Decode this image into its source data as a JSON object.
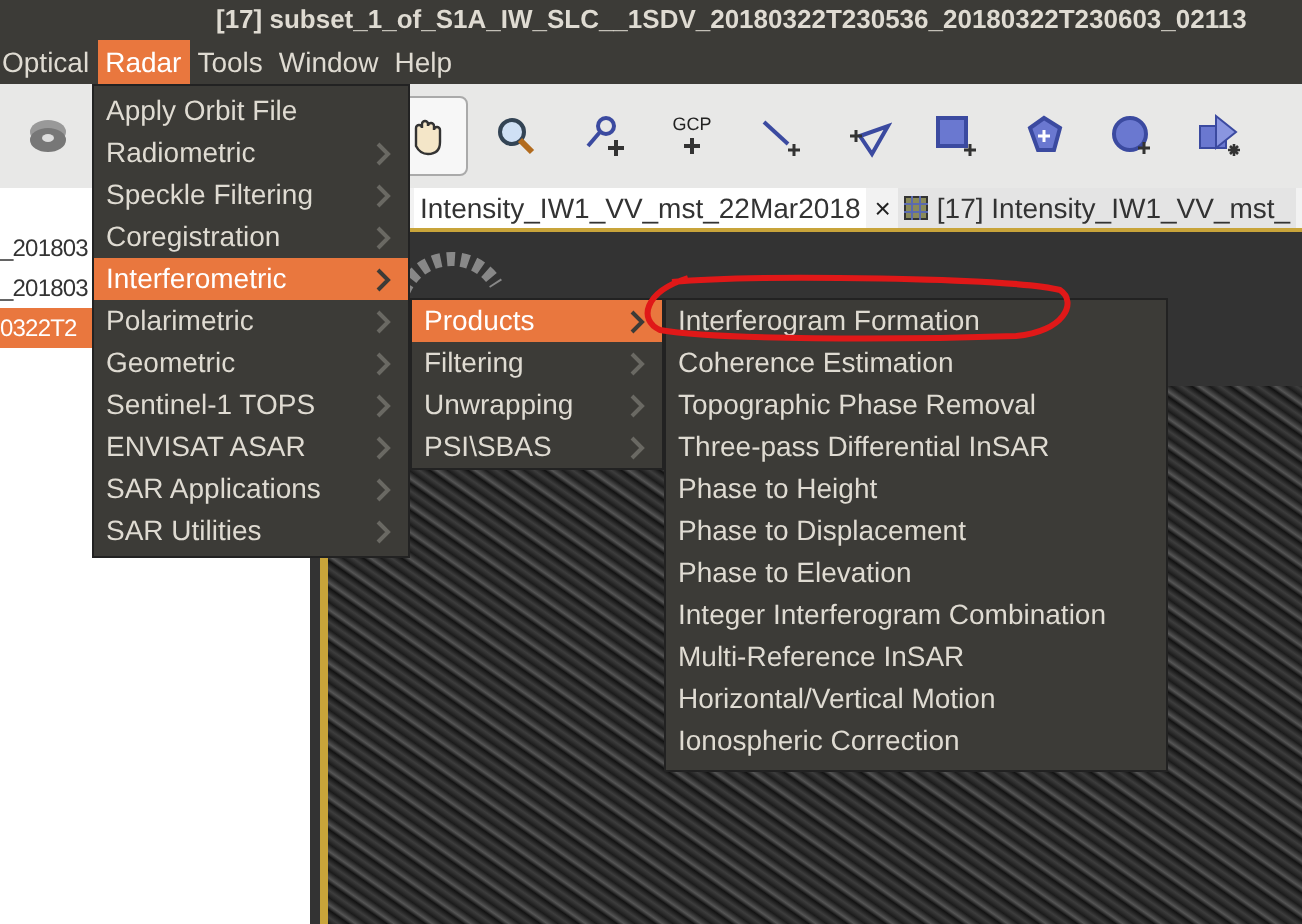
{
  "window": {
    "title": "[17] subset_1_of_S1A_IW_SLC__1SDV_20180322T230536_20180322T230603_02113"
  },
  "menubar": [
    {
      "label": "Optical",
      "selected": false
    },
    {
      "label": "Radar",
      "selected": true
    },
    {
      "label": "Tools",
      "selected": false
    },
    {
      "label": "Window",
      "selected": false
    },
    {
      "label": "Help",
      "selected": false
    }
  ],
  "toolbar": [
    {
      "kind": "disk",
      "selected": false
    },
    {
      "kind": "pan",
      "selected": true
    },
    {
      "kind": "zoom",
      "selected": false
    },
    {
      "kind": "pin",
      "selected": false
    },
    {
      "kind": "gcp",
      "label": "GCP",
      "selected": false
    },
    {
      "kind": "line",
      "selected": false
    },
    {
      "kind": "polyline",
      "selected": false
    },
    {
      "kind": "rect",
      "selected": false
    },
    {
      "kind": "polygon",
      "selected": false
    },
    {
      "kind": "ellipse",
      "selected": false
    },
    {
      "kind": "insert",
      "selected": false
    }
  ],
  "product_tree": [
    {
      "label": "_201803",
      "selected": false
    },
    {
      "label": "_201803",
      "selected": false
    },
    {
      "label": "0322T2",
      "selected": true
    }
  ],
  "tabs": [
    {
      "label": "Intensity_IW1_VV_mst_22Mar2018",
      "close": "×",
      "icon": false
    },
    {
      "label": "[17] Intensity_IW1_VV_mst_",
      "icon": true
    }
  ],
  "radar_menu": [
    {
      "label": "Apply Orbit File",
      "submenu": false,
      "selected": false
    },
    {
      "label": "Radiometric",
      "submenu": true,
      "selected": false
    },
    {
      "label": "Speckle Filtering",
      "submenu": true,
      "selected": false
    },
    {
      "label": "Coregistration",
      "submenu": true,
      "selected": false
    },
    {
      "label": "Interferometric",
      "submenu": true,
      "selected": true
    },
    {
      "label": "Polarimetric",
      "submenu": true,
      "selected": false
    },
    {
      "label": "Geometric",
      "submenu": true,
      "selected": false
    },
    {
      "label": "Sentinel-1 TOPS",
      "submenu": true,
      "selected": false
    },
    {
      "label": "ENVISAT ASAR",
      "submenu": true,
      "selected": false
    },
    {
      "label": "SAR Applications",
      "submenu": true,
      "selected": false
    },
    {
      "label": "SAR Utilities",
      "submenu": true,
      "selected": false
    }
  ],
  "interferometric_menu": [
    {
      "label": "Products",
      "submenu": true,
      "selected": true
    },
    {
      "label": "Filtering",
      "submenu": true,
      "selected": false
    },
    {
      "label": "Unwrapping",
      "submenu": true,
      "selected": false
    },
    {
      "label": "PSI\\SBAS",
      "submenu": true,
      "selected": false
    }
  ],
  "products_menu": [
    {
      "label": "Interferogram Formation",
      "circled": true
    },
    {
      "label": "Coherence Estimation",
      "circled": false
    },
    {
      "label": "Topographic Phase Removal",
      "circled": false
    },
    {
      "label": "Three-pass Differential InSAR",
      "circled": false
    },
    {
      "label": "Phase to Height",
      "circled": false
    },
    {
      "label": "Phase to Displacement",
      "circled": false
    },
    {
      "label": "Phase to Elevation",
      "circled": false
    },
    {
      "label": "Integer Interferogram Combination",
      "circled": false
    },
    {
      "label": "Multi-Reference InSAR",
      "circled": false
    },
    {
      "label": "Horizontal/Vertical Motion",
      "circled": false
    },
    {
      "label": "Ionospheric Correction",
      "circled": false
    }
  ]
}
